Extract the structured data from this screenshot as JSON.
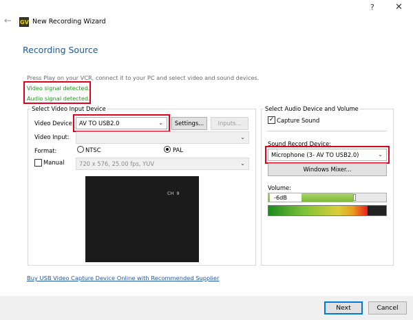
{
  "window": {
    "title": "New Recording Wizard",
    "app_icon_text": "GV",
    "back_icon": "arrow-left-icon",
    "help_label": "?",
    "close_label": "✕"
  },
  "page": {
    "heading": "Recording Source",
    "instructions": "Press Play on your VCR, connect it to your PC and select video and sound devices.",
    "video_signal": "Video signal detected.",
    "audio_signal": "Audio signal detected."
  },
  "video": {
    "group_label": "Select Video Input Device",
    "device_label": "Video Device:",
    "device_value": "AV TO USB2.0",
    "settings_button": "Settings...",
    "inputs_button": "Inputs...",
    "input_label": "Video Input:",
    "input_value": "",
    "format_label": "Format:",
    "ntsc_label": "NTSC",
    "pal_label": "PAL",
    "selected_format": "PAL",
    "manual_label": "Manual",
    "manual_checked": false,
    "mode_value": "720 x 576, 25.00 fps, YUV",
    "preview_overlay": "CH  9"
  },
  "audio": {
    "group_label": "Select Audio Device and Volume",
    "capture_label": "Capture Sound",
    "capture_checked": true,
    "sound_device_label": "Sound Record Device:",
    "sound_device_value": "Microphone (3- AV TO USB2.0)",
    "mixer_button": "Windows Mixer...",
    "volume_label": "Volume:",
    "volume_value": "-6dB",
    "volume_fraction": 0.72,
    "level_fraction": 0.84
  },
  "footer": {
    "link_text": "Buy USB Video Capture Device Online with Recommended Supplier",
    "next_button": "Next",
    "cancel_button": "Cancel"
  },
  "colors": {
    "accent": "#1f5a96",
    "signal_green": "#1a9a1a",
    "highlight_red": "#e0001b",
    "link": "#1f5aa8"
  }
}
